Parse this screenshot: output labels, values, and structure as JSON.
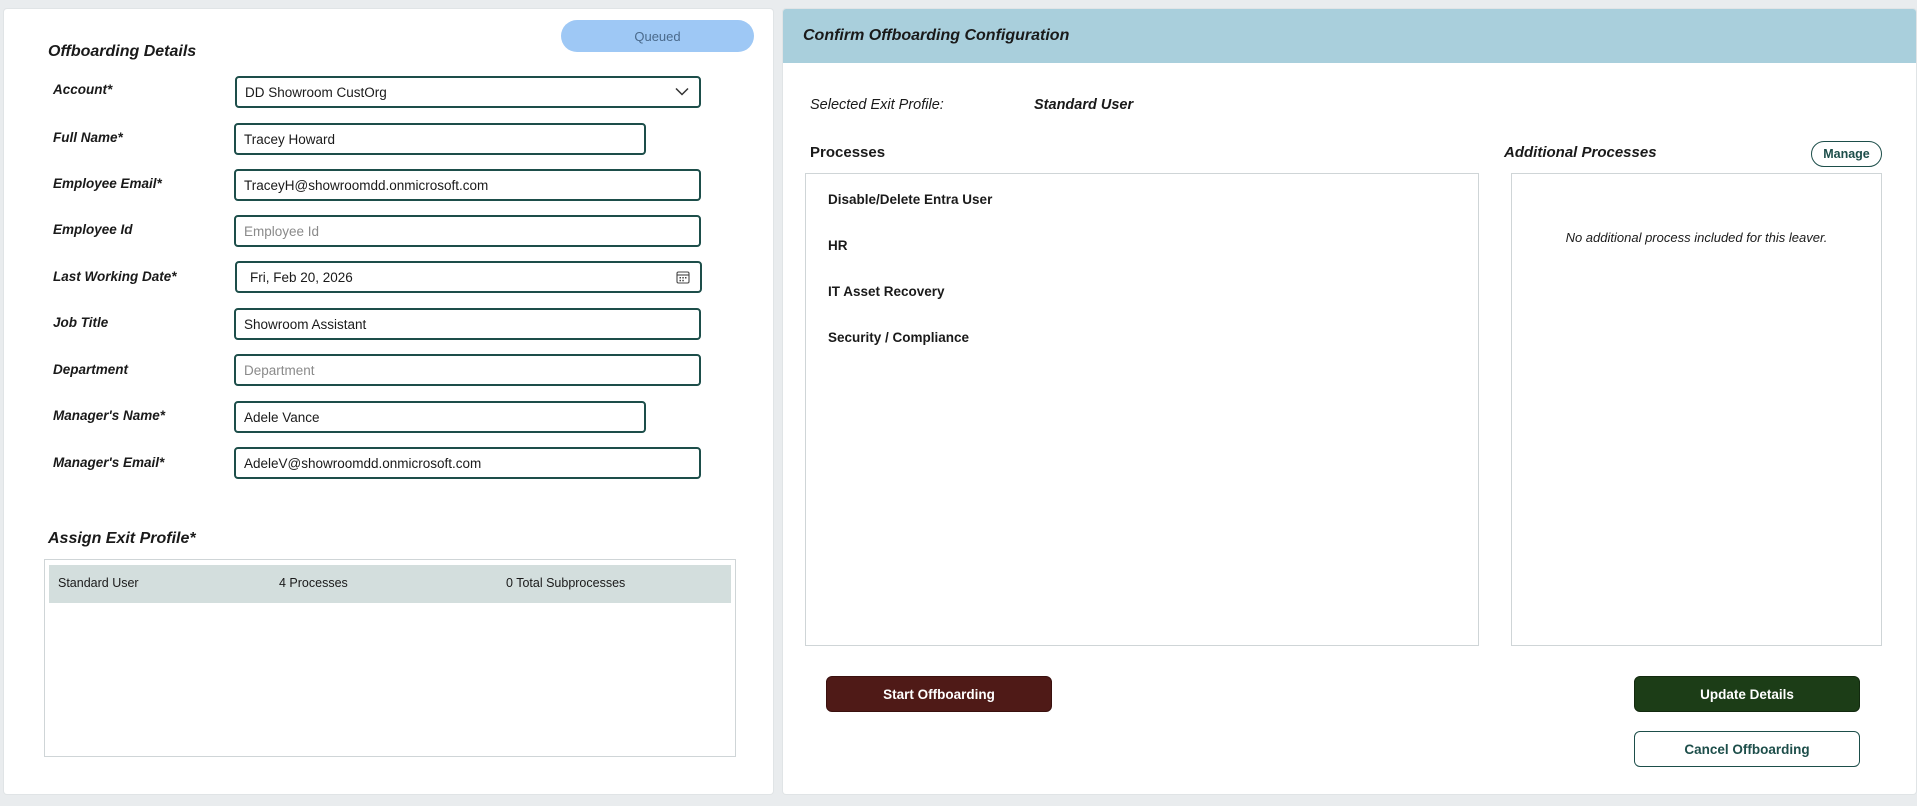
{
  "status": "Queued",
  "offboarding": {
    "title": "Offboarding Details",
    "fields": {
      "account": {
        "label": "Account*",
        "value": "DD Showroom CustOrg"
      },
      "full_name": {
        "label": "Full Name*",
        "value": "Tracey Howard"
      },
      "employee_email": {
        "label": "Employee Email*",
        "value": "TraceyH@showroomdd.onmicrosoft.com"
      },
      "employee_id": {
        "label": "Employee Id",
        "placeholder": "Employee Id"
      },
      "last_working_date": {
        "label": "Last Working Date*",
        "value": "Fri, Feb 20, 2026"
      },
      "job_title": {
        "label": "Job Title",
        "value": "Showroom Assistant"
      },
      "department": {
        "label": "Department",
        "placeholder": "Department"
      },
      "manager_name": {
        "label": "Manager's Name*",
        "value": "Adele Vance"
      },
      "manager_email": {
        "label": "Manager's Email*",
        "value": "AdeleV@showroomdd.onmicrosoft.com"
      }
    }
  },
  "exit_profile": {
    "title": "Assign Exit Profile*",
    "rows": [
      {
        "name": "Standard User",
        "processes": "4 Processes",
        "subprocesses": "0 Total Subprocesses"
      }
    ]
  },
  "confirm": {
    "title": "Confirm Offboarding Configuration",
    "selected_label": "Selected Exit Profile:",
    "selected_value": "Standard User",
    "processes_title": "Processes",
    "processes": [
      "Disable/Delete Entra User",
      "HR",
      "IT Asset Recovery",
      "Security / Compliance"
    ],
    "additional_title": "Additional Processes",
    "manage_label": "Manage",
    "additional_empty": "No additional process included for this leaver."
  },
  "buttons": {
    "start": "Start Offboarding",
    "update": "Update Details",
    "cancel": "Cancel Offboarding"
  },
  "colors": {
    "accent": "#1d4e4a",
    "header_bg": "#a9cfdc",
    "status_pill": "#9ec8f5",
    "start_button": "#4f1a17",
    "update_button": "#1c3d17"
  },
  "icons": [
    "chevron-down-icon",
    "calendar-icon"
  ]
}
